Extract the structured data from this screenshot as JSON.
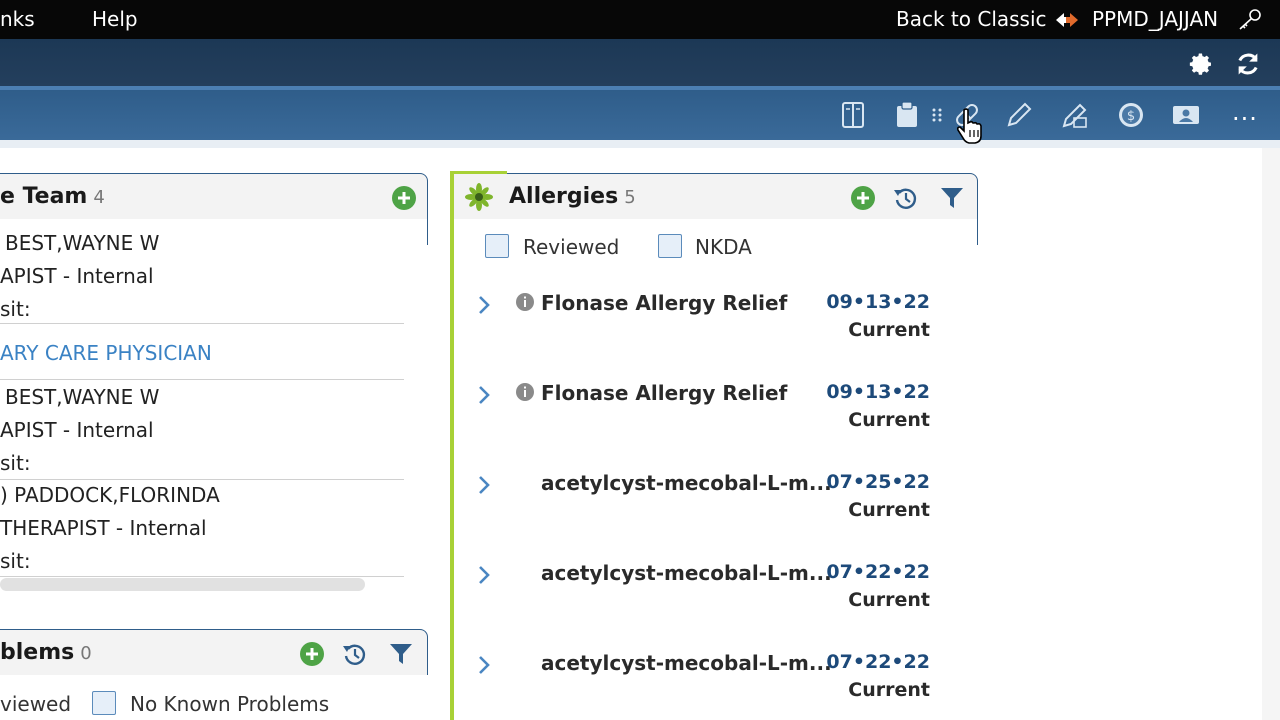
{
  "topbar": {
    "links_label": "nks",
    "help_label": "Help",
    "back_to_classic": "Back to Classic",
    "username": "PPMD_JAJJAN"
  },
  "toolbar": {
    "more_label": "..."
  },
  "care_team": {
    "title": "e Team",
    "count": "4",
    "lines": [
      "BEST,WAYNE W",
      "APIST - Internal",
      "sit:",
      "ARY CARE PHYSICIAN",
      "BEST,WAYNE W",
      "APIST - Internal",
      "sit:",
      ") PADDOCK,FLORINDA",
      "THERAPIST - Internal",
      "sit:"
    ]
  },
  "problems": {
    "title": "blems",
    "count": "0",
    "reviewed_label": "viewed",
    "no_known_label": "No Known Problems"
  },
  "allergies": {
    "title": "Allergies",
    "count": "5",
    "reviewed_label": "Reviewed",
    "nkda_label": "NKDA",
    "rows": [
      {
        "name": "Flonase Allergy Relief",
        "date": "09•13•22",
        "status": "Current",
        "has_info": true
      },
      {
        "name": "Flonase Allergy Relief",
        "date": "09•13•22",
        "status": "Current",
        "has_info": true
      },
      {
        "name": "acetylcyst-mecobal-L-m...",
        "date": "07•25•22",
        "status": "Current",
        "has_info": false
      },
      {
        "name": "acetylcyst-mecobal-L-m...",
        "date": "07•22•22",
        "status": "Current",
        "has_info": false
      },
      {
        "name": "acetylcyst-mecobal-L-m...",
        "date": "07•22•22",
        "status": "Current",
        "has_info": false
      }
    ]
  },
  "colors": {
    "add_green": "#4ea346",
    "accent_green": "#a8d136",
    "link_blue": "#3a82c4",
    "header_blue": "#2f5d8a"
  },
  "icons": {
    "toolbar": [
      "notebook-icon",
      "clipboard-icon",
      "drag-handle-icon",
      "pill-icon",
      "pencil-icon",
      "pencil-edit-icon",
      "dollar-icon",
      "id-card-icon"
    ],
    "header": [
      "add-icon",
      "history-icon",
      "filter-icon"
    ]
  }
}
